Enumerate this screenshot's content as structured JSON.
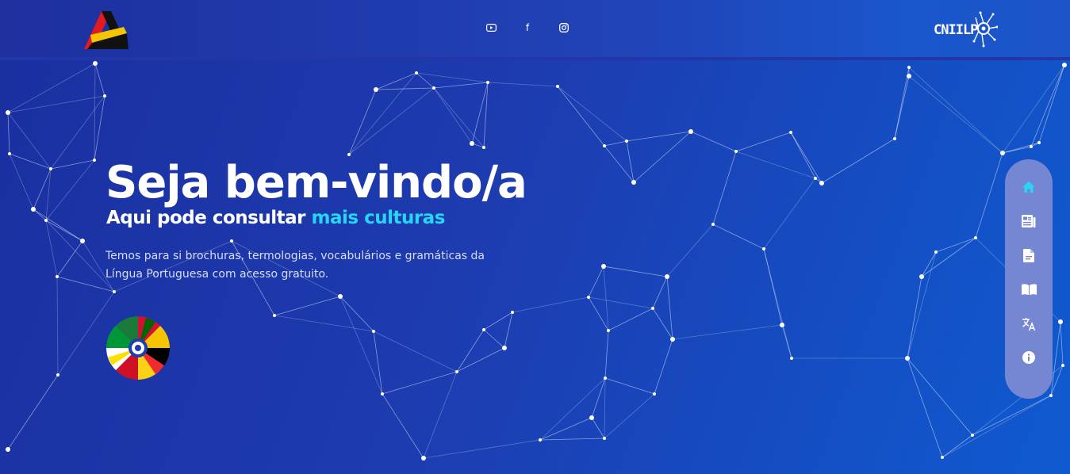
{
  "header": {
    "left_logo_icon": "angola-a-logo-icon",
    "socials": [
      {
        "name": "youtube-icon"
      },
      {
        "name": "facebook-icon",
        "glyph": "f"
      },
      {
        "name": "instagram-icon"
      }
    ],
    "right_logo_text": "CNIILP"
  },
  "hero": {
    "title": "Seja bem-vindo/a",
    "subtitle_prefix": "Aqui pode consultar ",
    "subtitle_highlight": "mais culturas",
    "description": "Temos para si brochuras, termologias, vocabulários e gramáticas da Língua Portuguesa com acesso gratuito.",
    "flags_icon": "lusophone-flags-globe-icon"
  },
  "side_nav": {
    "items": [
      {
        "name": "home-icon",
        "active": true
      },
      {
        "name": "newspaper-icon"
      },
      {
        "name": "document-icon"
      },
      {
        "name": "book-icon"
      },
      {
        "name": "translate-icon"
      },
      {
        "name": "info-icon"
      }
    ]
  },
  "colors": {
    "highlight": "#27d6f5",
    "active_nav": "#27d6f5",
    "side_nav_bg": "#7586d3"
  }
}
